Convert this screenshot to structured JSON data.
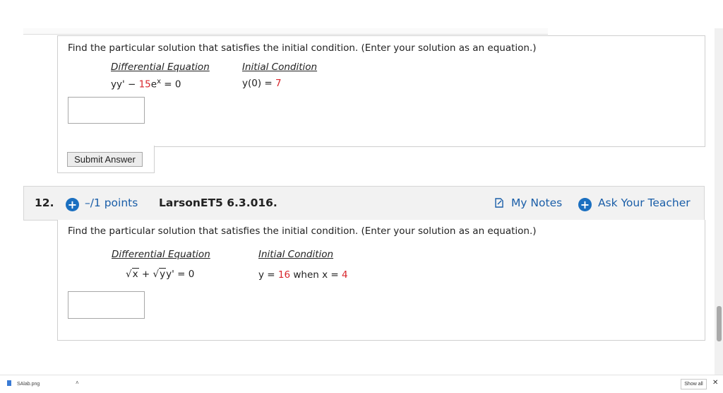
{
  "question11": {
    "prompt": "Find the particular solution that satisfies the initial condition. (Enter your solution as an equation.)",
    "de_header": "Differential Equation",
    "ic_header": "Initial Condition",
    "de_part1": "yy' − ",
    "de_coef": "15",
    "de_part2": "e",
    "de_sup": "x",
    "de_part3": " = 0",
    "ic_part1": "y(0) = ",
    "ic_value": "7",
    "answer_value": "",
    "submit_label": "Submit Answer"
  },
  "question12": {
    "number": "12.",
    "points": "–/1 points",
    "reference": "LarsonET5 6.3.016.",
    "my_notes": "My Notes",
    "ask_teacher": "Ask Your Teacher",
    "prompt": "Find the particular solution that satisfies the initial condition. (Enter your solution as an equation.)",
    "de_header": "Differential Equation",
    "ic_header": "Initial Condition",
    "de_rad1": "x",
    "de_plus": " + ",
    "de_rad2": "y",
    "de_tail": "y' = 0",
    "ic_part1": "y = ",
    "ic_value1": "16",
    "ic_part2": " when x = ",
    "ic_value2": "4",
    "answer_value": ""
  },
  "download_bar": {
    "filename": "SAlab.png",
    "show_all": "Show all"
  },
  "colors": {
    "accent": "#1a6fc0",
    "value_red": "#d8262c"
  },
  "icons": [
    "plus-circle-icon",
    "notes-icon",
    "chevron-up-icon",
    "close-icon",
    "file-icon"
  ]
}
